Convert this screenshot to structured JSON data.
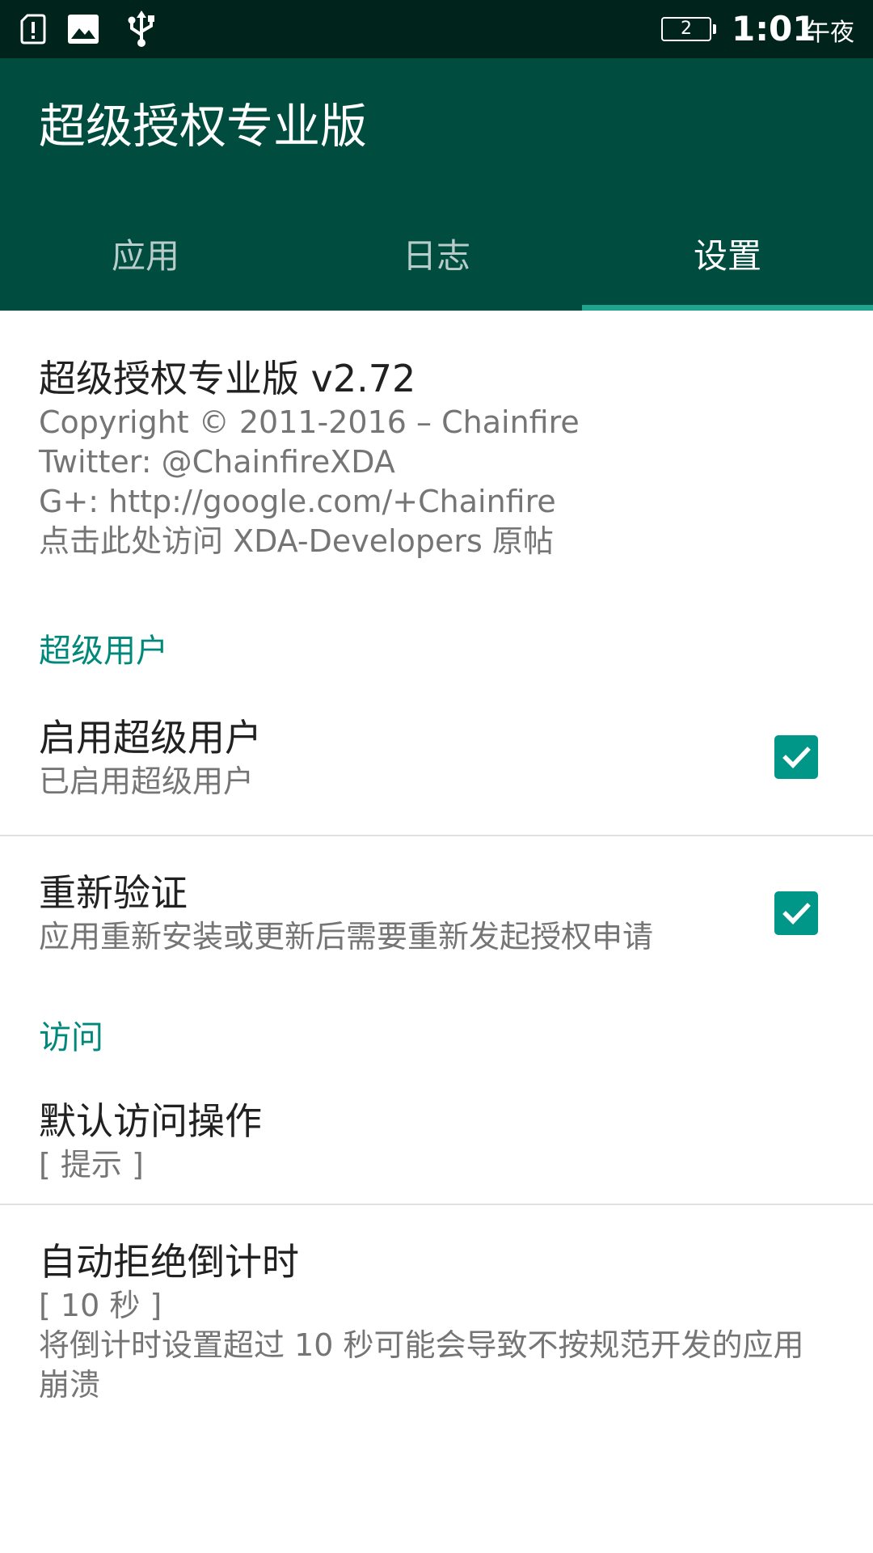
{
  "status_bar": {
    "icons": [
      "alert-icon",
      "image-icon",
      "usb-icon"
    ],
    "battery": "2",
    "time": "1:01",
    "ampm": "午夜"
  },
  "app_bar": {
    "title": "超级授权专业版",
    "tabs": [
      {
        "label": "应用",
        "active": false
      },
      {
        "label": "日志",
        "active": false
      },
      {
        "label": "设置",
        "active": true
      }
    ]
  },
  "about": {
    "title": "超级授权专业版 v2.72",
    "lines": [
      "Copyright © 2011-2016 – Chainfire",
      "Twitter: @ChainfireXDA",
      "G+: http://google.com/+Chainfire",
      "点击此处访问 XDA-Developers 原帖"
    ]
  },
  "superuser_section": {
    "header": "超级用户",
    "enable": {
      "title": "启用超级用户",
      "summary": "已启用超级用户",
      "checked": true
    },
    "reauth": {
      "title": "重新验证",
      "summary": "应用重新安装或更新后需要重新发起授权申请",
      "checked": true
    }
  },
  "access_section": {
    "header": "访问",
    "default_action": {
      "title": "默认访问操作",
      "summary": "[ 提示 ]"
    },
    "auto_deny": {
      "title": "自动拒绝倒计时",
      "summary_value": "[ 10 秒 ]",
      "summary_note": "将倒计时设置超过 10 秒可能会导致不按规范开发的应用崩溃"
    }
  },
  "colors": {
    "status_bar": "#00231b",
    "app_bar": "#004d40",
    "accent": "#009688",
    "category_text": "#00897b",
    "tab_indicator": "#1fa58f"
  }
}
